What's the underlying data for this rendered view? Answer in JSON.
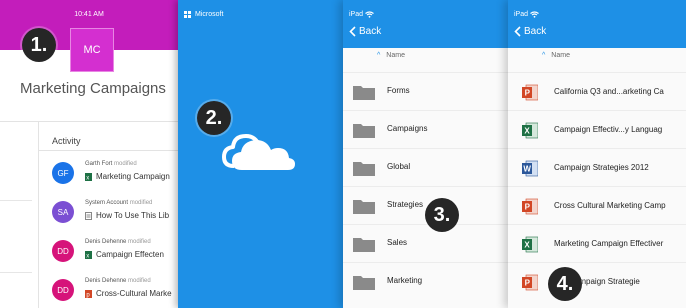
{
  "badges": [
    "1.",
    "2.",
    "3.",
    "4."
  ],
  "colors": {
    "magenta": "#c31dbb",
    "blue": "#1e90e6"
  },
  "site_panel": {
    "time": "10:41 AM",
    "initials": "MC",
    "title": "Marketing Campaigns",
    "activity_header": "Activity",
    "modified_word": "modified",
    "activity": [
      {
        "initials": "GF",
        "avatar_color": "#1a73e8",
        "person": "Garth Fort",
        "file": "Marketing Campaign",
        "file_icon": "excel-icon"
      },
      {
        "initials": "SA",
        "avatar_color": "#7b4fd3",
        "person": "System Account",
        "file": "How To Use This Lib",
        "file_icon": "page-icon"
      },
      {
        "initials": "DD",
        "avatar_color": "#d6137a",
        "person": "Denis Dehenne",
        "file": "Campaign Effecten",
        "file_icon": "excel-icon"
      },
      {
        "initials": "DD",
        "avatar_color": "#d6137a",
        "person": "Denis Dehenne",
        "file": "Cross-Cultural Marke",
        "file_icon": "powerpoint-icon"
      }
    ]
  },
  "onedrive_panel": {
    "brand": "Microsoft",
    "icon": "cloud-icon"
  },
  "folders_panel": {
    "status": "iPad",
    "back_label": "Back",
    "sort_label": "Name",
    "folders": [
      "Forms",
      "Campaigns",
      "Global",
      "Strategies",
      "Sales",
      "Marketing"
    ]
  },
  "files_panel": {
    "status": "iPad",
    "back_label": "Back",
    "sort_label": "Name",
    "files": [
      {
        "name": "California Q3 and...arketing Ca",
        "type": "powerpoint"
      },
      {
        "name": "Campaign Effectiv...y Languag",
        "type": "excel"
      },
      {
        "name": "Campaign Strategies 2012",
        "type": "word"
      },
      {
        "name": "Cross Cultural Marketing Camp",
        "type": "powerpoint"
      },
      {
        "name": "Marketing Campaign Effectiver",
        "type": "excel"
      },
      {
        "name": "ting Campaign Strategie",
        "type": "powerpoint"
      }
    ]
  }
}
